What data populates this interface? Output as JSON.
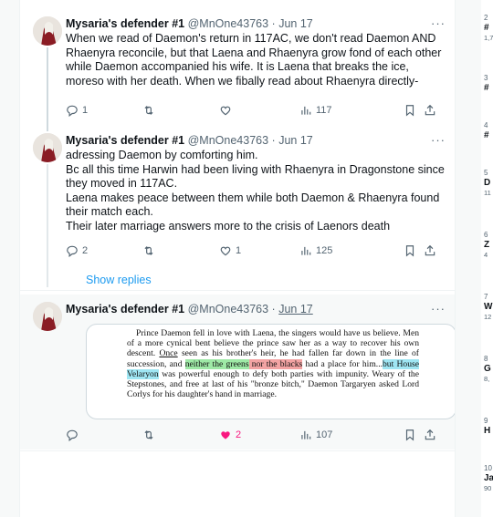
{
  "tweets": [
    {
      "name": "Mysaria's defender #1",
      "handle": "@MnOne43763",
      "sep": "·",
      "date": "Jun 17",
      "text": "When we read of Daemon's return in 117AC, we don't read Daemon AND Rhaenyra reconcile, but that Laena and Rhaenyra grow fond of each other while Daemon accompanied his wife. It is Laena that breaks the ice, moreso with her death. When we fibally read about Rhaenyra directly-",
      "replies": "1",
      "likes": "",
      "views": "117"
    },
    {
      "name": "Mysaria's defender #1",
      "handle": "@MnOne43763",
      "sep": "·",
      "date": "Jun 17",
      "text_lines": [
        "adressing Daemon by comforting him.",
        "Bc all this time Harwin had been living with Rhaenyra in Dragonstone since they moved in 117AC.",
        "Laena makes peace between them while both Daemon & Rhaenyra found their match each.",
        "Their later marriage answers more to the crisis of Laenors death"
      ],
      "replies": "2",
      "likes": "1",
      "views": "125"
    },
    {
      "name": "Mysaria's defender #1",
      "handle": "@MnOne43763",
      "sep": "·",
      "date": "Jun 17",
      "replies": "",
      "likes": "2",
      "views": "107"
    }
  ],
  "show_replies": "Show replies",
  "more_label": "···",
  "quote": {
    "p1": "Prince Daemon fell in love with Laena, the singers would have us believe. Men of a more cynical bent believe the prince saw her as a way to recover his own descent. ",
    "once": "Once",
    "p2": " seen as his brother's heir, he had fallen far down in the line of succession, and ",
    "green": "neither the greens",
    "red1": " nor the blacks",
    "p3": " had a place for him...",
    "blue": "but House Velaryon",
    "p4": " was powerful enough to defy both parties with impunity. Weary of the Stepstones, and free at last of his \"bronze bitch,\" Daemon Targaryen asked Lord Corlys for his daughter's hand in marriage."
  },
  "trends": [
    {
      "num": "2",
      "label": "#",
      "count": "1,7"
    },
    {
      "num": "3",
      "label": "#",
      "count": ""
    },
    {
      "num": "4",
      "label": "#",
      "count": ""
    },
    {
      "num": "5",
      "label": "D",
      "count": "11"
    },
    {
      "num": "6",
      "label": "Z",
      "count": "4"
    },
    {
      "num": "7",
      "label": "W",
      "count": "12"
    },
    {
      "num": "8",
      "label": "G",
      "count": "8,"
    },
    {
      "num": "9",
      "label": "H",
      "count": ""
    },
    {
      "num": "10",
      "label": "Ja",
      "count": "90"
    }
  ],
  "colors": {
    "accent": "#1d9bf0",
    "like": "#f91880",
    "muted": "#536471"
  }
}
